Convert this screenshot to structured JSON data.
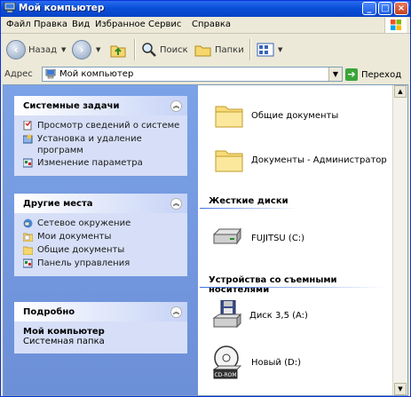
{
  "window": {
    "title": "Мой компьютер"
  },
  "menu": [
    "Файл",
    "Правка",
    "Вид",
    "Избранное",
    "Сервис",
    "Справка"
  ],
  "toolbar": {
    "back": "Назад",
    "search": "Поиск",
    "folders": "Папки"
  },
  "address": {
    "label": "Адрес",
    "value": "Мой компьютер",
    "go": "Переход"
  },
  "tasks": {
    "system": {
      "title": "Системные задачи",
      "items": [
        "Просмотр сведений о системе",
        "Установка и удаление программ",
        "Изменение параметра"
      ]
    },
    "places": {
      "title": "Другие места",
      "items": [
        "Сетевое окружение",
        "Мои документы",
        "Общие документы",
        "Панель управления"
      ]
    },
    "details": {
      "title": "Подробно",
      "name": "Мой компьютер",
      "type": "Системная папка"
    }
  },
  "files": {
    "folders": [
      "Общие документы",
      "Документы - Администратор"
    ],
    "hdd_header": "Жесткие диски",
    "hdd": [
      "FUJITSU (C:)"
    ],
    "removable_header": "Устройства со съемными носителями",
    "removable": [
      "Диск 3,5 (A:)",
      "Новый (D:)"
    ],
    "cdrom_badge": "CD-ROM"
  },
  "colors": {
    "titlebar": "#0a4fd8",
    "taskpane": "#7ba2e7",
    "panel_body": "#d6dff7"
  }
}
